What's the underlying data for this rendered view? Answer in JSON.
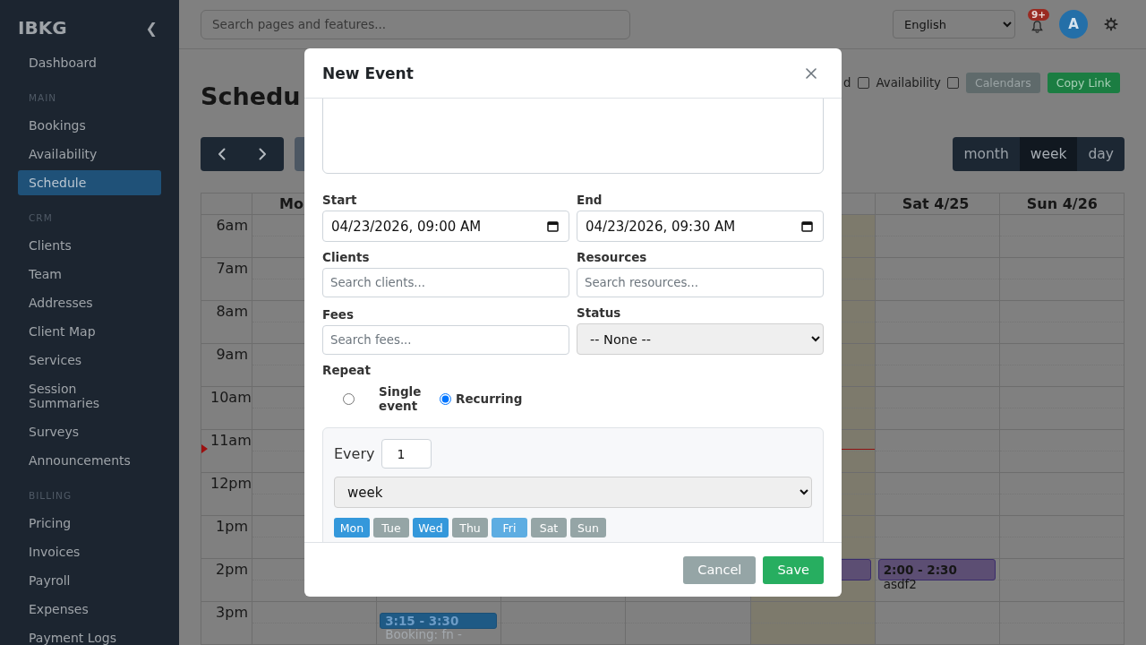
{
  "sidebar": {
    "brand": "IBKG",
    "collapse_label": "❮",
    "items": [
      {
        "kind": "link",
        "label": "Dashboard",
        "selected": false
      },
      {
        "kind": "heading",
        "label": "MAIN"
      },
      {
        "kind": "link",
        "label": "Bookings",
        "selected": false
      },
      {
        "kind": "link",
        "label": "Availability",
        "selected": false
      },
      {
        "kind": "link",
        "label": "Schedule",
        "selected": true
      },
      {
        "kind": "heading",
        "label": "CRM"
      },
      {
        "kind": "link",
        "label": "Clients",
        "selected": false
      },
      {
        "kind": "link",
        "label": "Team",
        "selected": false
      },
      {
        "kind": "link",
        "label": "Addresses",
        "selected": false
      },
      {
        "kind": "link",
        "label": "Client Map",
        "selected": false
      },
      {
        "kind": "link",
        "label": "Services",
        "selected": false
      },
      {
        "kind": "link",
        "label": "Session Summaries",
        "selected": false
      },
      {
        "kind": "link",
        "label": "Surveys",
        "selected": false
      },
      {
        "kind": "link",
        "label": "Announcements",
        "selected": false
      },
      {
        "kind": "heading",
        "label": "BILLING"
      },
      {
        "kind": "link",
        "label": "Pricing",
        "selected": false
      },
      {
        "kind": "link",
        "label": "Invoices",
        "selected": false
      },
      {
        "kind": "link",
        "label": "Payroll",
        "selected": false
      },
      {
        "kind": "link",
        "label": "Expenses",
        "selected": false
      },
      {
        "kind": "link",
        "label": "Payment Logs",
        "selected": false
      }
    ]
  },
  "topbar": {
    "search": {
      "placeholder": "Search pages and features..."
    },
    "language": {
      "value": "English"
    },
    "notifications": {
      "badge": "9+"
    },
    "avatar": {
      "initial": "A"
    }
  },
  "page": {
    "title": "Schedu",
    "filters": [
      {
        "label": "d",
        "checked": false
      },
      {
        "label": "Availability",
        "checked": false
      }
    ],
    "actions": [
      {
        "kind": "secondary",
        "label": "Calendars"
      },
      {
        "kind": "success",
        "label": "Copy Link"
      }
    ],
    "views": [
      {
        "label": "month",
        "selected": false
      },
      {
        "label": "week",
        "selected": true
      },
      {
        "label": "day",
        "selected": false
      }
    ]
  },
  "calendar": {
    "days": [
      {
        "label": "Mo",
        "today": false
      },
      {
        "today": false
      },
      {
        "today": false
      },
      {
        "today": false
      },
      {
        "today": true
      },
      {
        "label": "Sat 4/25",
        "today": false
      },
      {
        "label": "Sun 4/26",
        "today": false
      }
    ],
    "hours": [
      {
        "label": "6am"
      },
      {
        "label": "7am"
      },
      {
        "label": "8am"
      },
      {
        "label": "9am"
      },
      {
        "label": "10am"
      },
      {
        "label": "11am"
      },
      {
        "label": "12pm"
      },
      {
        "label": "1pm"
      },
      {
        "label": "2pm",
        "cells": [
          {},
          {},
          {},
          {},
          {
            "events": [
              {
                "kind": "appointment",
                "color": "#5c4e73"
              }
            ]
          },
          {
            "events": [
              {
                "kind": "appointment",
                "time": "2:00 - 2:30",
                "title": "asdf2",
                "color": "#5c4e73"
              }
            ]
          },
          {}
        ]
      },
      {
        "label": "3pm",
        "cells": [
          {},
          {
            "events": [
              {
                "kind": "booking",
                "time": "3:15 - 3:30",
                "title": "Booking: fn -",
                "color": "#1f5a85"
              }
            ]
          },
          {},
          {},
          {},
          {},
          {}
        ]
      }
    ]
  },
  "modal": {
    "title": "New Event",
    "fields": [
      {
        "kind": "datetime",
        "label": "Start",
        "value": "04/23/2026, 09:00 AM"
      },
      {
        "kind": "datetime",
        "label": "End",
        "value": "04/23/2026, 09:30 AM"
      },
      {
        "kind": "search",
        "label": "Clients",
        "placeholder": "Search clients..."
      },
      {
        "kind": "search",
        "label": "Resources",
        "placeholder": "Search resources..."
      },
      {
        "kind": "search",
        "label": "Fees",
        "placeholder": "Search fees..."
      },
      {
        "kind": "select",
        "label": "Status",
        "value": "-- None --"
      }
    ],
    "repeat": {
      "label": "Repeat",
      "options": [
        {
          "kind": "single",
          "label": "Single event",
          "selected": false
        },
        {
          "kind": "recurring",
          "label": "Recurring",
          "selected": true
        }
      ],
      "every_label": "Every",
      "interval": "1",
      "unit": "week",
      "days": [
        {
          "label": "Mon",
          "selected": true,
          "hovered": false
        },
        {
          "label": "Tue",
          "selected": false,
          "hovered": false
        },
        {
          "label": "Wed",
          "selected": true,
          "hovered": false
        },
        {
          "label": "Thu",
          "selected": false,
          "hovered": false
        },
        {
          "label": "Fri",
          "selected": true,
          "hovered": true
        },
        {
          "label": "Sat",
          "selected": false,
          "hovered": false
        },
        {
          "label": "Sun",
          "selected": false,
          "hovered": false
        }
      ]
    },
    "buttons": [
      {
        "kind": "secondary",
        "label": "Cancel"
      },
      {
        "kind": "primary",
        "label": "Save"
      }
    ]
  }
}
